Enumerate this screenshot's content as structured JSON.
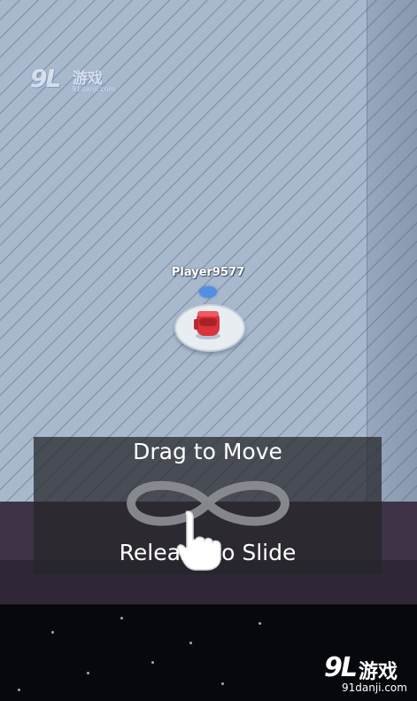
{
  "watermark": {
    "logo_number": "9L",
    "logo_chinese": "游戏",
    "logo_url": "91danji.com"
  },
  "player": {
    "name": "Player9577",
    "marker_color": "#4f8fe6",
    "body_color": "#d8343a"
  },
  "tutorial": {
    "top_text": "Drag to Move",
    "bottom_text": "Release to Slide",
    "gesture_icon": "infinity-gesture-icon",
    "hand_icon": "pointing-hand-icon"
  },
  "colors": {
    "ice": "#a9b9cd",
    "wall": "#3e3347",
    "space": "#07080d"
  }
}
